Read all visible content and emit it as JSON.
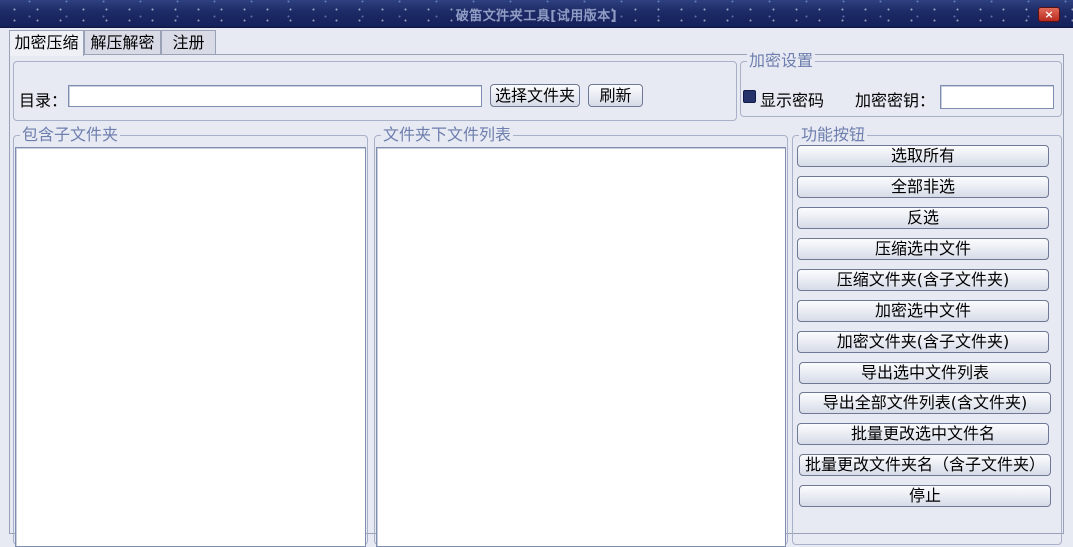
{
  "window": {
    "title": "破笛文件夹工具[试用版本]",
    "close_label": "×"
  },
  "tabs": [
    {
      "label": "加密压缩",
      "active": true
    },
    {
      "label": "解压解密",
      "active": false
    },
    {
      "label": "注册",
      "active": false
    }
  ],
  "directory": {
    "label": "目录：",
    "value": "",
    "choose_folder_label": "选择文件夹",
    "refresh_label": "刷新"
  },
  "encryption": {
    "group_title": "加密设置",
    "show_password_label": "显示密码",
    "show_password_checked": true,
    "key_label": "加密密钥：",
    "key_value": ""
  },
  "subfolders": {
    "group_title": "包含子文件夹",
    "items": []
  },
  "files": {
    "group_title": "文件夹下文件列表",
    "items": []
  },
  "functions": {
    "group_title": "功能按钮",
    "buttons": [
      "选取所有",
      "全部非选",
      "反选",
      "压缩选中文件",
      "压缩文件夹(含子文件夹)",
      "加密选中文件",
      "加密文件夹(含子文件夹)",
      "导出选中文件列表",
      "导出全部文件列表(含文件夹)",
      "批量更改选中文件名",
      "批量更改文件夹名（含子文件夹）",
      "停止"
    ]
  }
}
